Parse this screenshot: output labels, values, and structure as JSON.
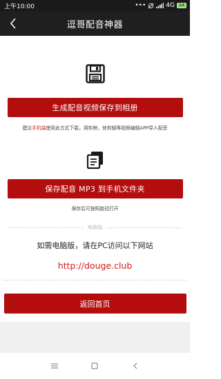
{
  "status_bar": {
    "time": "上午10:00",
    "signal_text": "4G",
    "battery": "14"
  },
  "nav": {
    "title": "逗哥配音神器"
  },
  "video_section": {
    "button_label": "生成配音视频保存到相册",
    "hint_prefix": "建议",
    "hint_accent": "手机端",
    "hint_suffix": "使用此方式下载，用剪映，快剪辑等视频编辑APP导入配音"
  },
  "mp3_section": {
    "button_label": "保存配音 MP3 到手机文件夹",
    "hint": "保存后可按照路径打开"
  },
  "pc_section": {
    "divider_label": "电脑端",
    "text": "如需电脑版，请在PC访问以下网站",
    "link": "http://douge.club"
  },
  "footer": {
    "home_button": "返回首页"
  },
  "colors": {
    "accent": "#b30d0d",
    "link": "#d11a1a",
    "header": "#1f1f1f"
  },
  "icons": {
    "save": "floppy-disk-icon",
    "file": "file-stack-icon",
    "back": "chevron-left-icon",
    "menu": "menu-lines-icon",
    "home": "square-home-icon",
    "sys_back": "triangle-back-icon"
  }
}
